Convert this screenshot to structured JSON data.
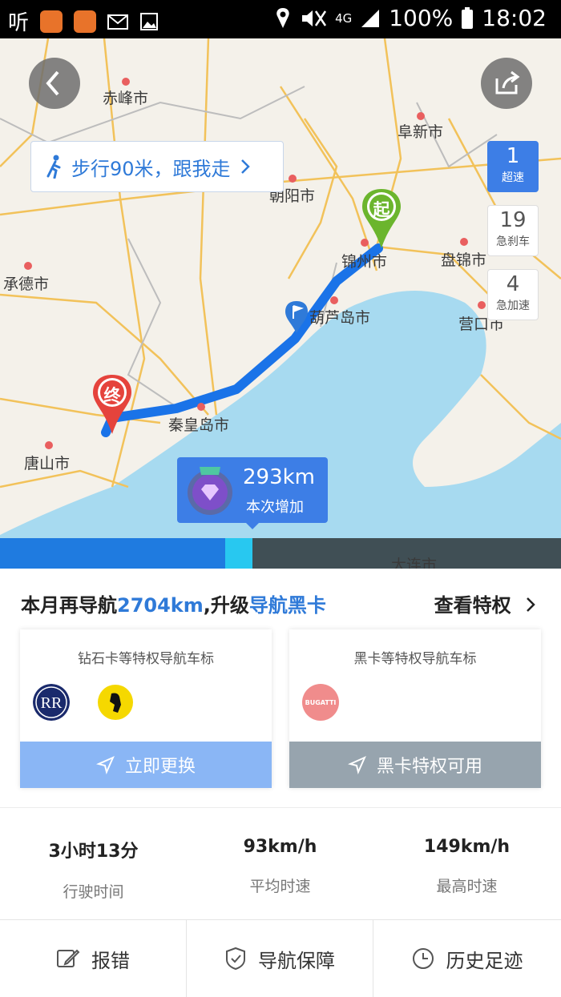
{
  "status_bar": {
    "app_glyph": "听",
    "battery": "100%",
    "network": "4G",
    "time": "18:02"
  },
  "map": {
    "cities": [
      {
        "name": "赤峰市",
        "id": "chifeng"
      },
      {
        "name": "阜新市",
        "id": "fuxin"
      },
      {
        "name": "朝阳市",
        "id": "chaoyang"
      },
      {
        "name": "锦州市",
        "id": "jinzhou"
      },
      {
        "name": "盘锦市",
        "id": "panjin"
      },
      {
        "name": "承德市",
        "id": "chengde"
      },
      {
        "name": "葫芦岛市",
        "id": "huludao"
      },
      {
        "name": "营口市",
        "id": "yingkou"
      },
      {
        "name": "秦皇岛市",
        "id": "qinhuangdao"
      },
      {
        "name": "唐山市",
        "id": "tangshan"
      },
      {
        "name": "大连市",
        "id": "dalian"
      }
    ],
    "walk_banner": "步行90米，跟我走",
    "start_marker": "起",
    "end_marker": "终",
    "speed_events": [
      {
        "count": "1",
        "label": "超速"
      },
      {
        "count": "19",
        "label": "急刹车"
      },
      {
        "count": "4",
        "label": "急加速"
      }
    ],
    "distance_bubble": {
      "value": "293km",
      "label": "本次增加"
    },
    "progress_fraction": 0.45
  },
  "upgrade": {
    "prefix": "本月再导航",
    "distance": "2704km",
    "middle": ",升级",
    "tier": "导航黑卡",
    "link": "查看特权"
  },
  "badge_cards": [
    {
      "title": "钻石卡等特权导航车标",
      "button": "立即更换",
      "button_color": "#8ab6f5"
    },
    {
      "title": "黑卡等特权导航车标",
      "button": "黑卡特权可用",
      "button_color": "#97a4ae"
    }
  ],
  "logos": {
    "bugatti": "BUGATTI"
  },
  "stats": [
    {
      "value": "3小时13分",
      "label": "行驶时间"
    },
    {
      "value": "93km/h",
      "label": "平均时速"
    },
    {
      "value": "149km/h",
      "label": "最高时速"
    }
  ],
  "actions": [
    {
      "label": "报错",
      "icon": "edit-icon"
    },
    {
      "label": "导航保障",
      "icon": "shield-check-icon"
    },
    {
      "label": "历史足迹",
      "icon": "clock-icon"
    }
  ],
  "colors": {
    "accent": "#2f7ad8",
    "route": "#1a73e8",
    "sea": "#a7daf0"
  }
}
